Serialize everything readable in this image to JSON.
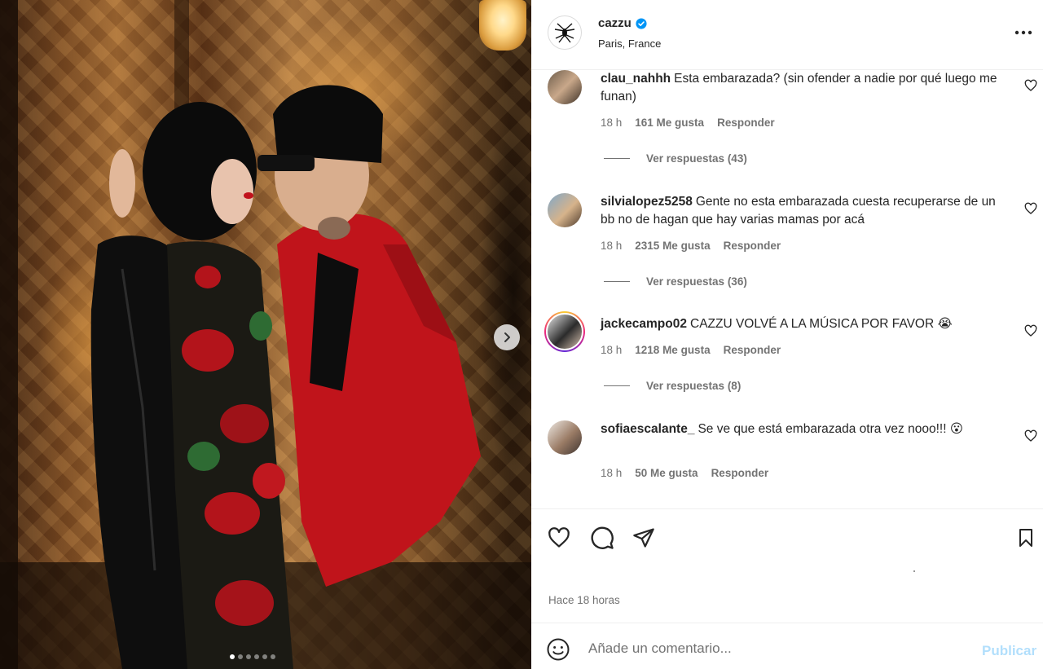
{
  "post": {
    "username": "cazzu",
    "verified": true,
    "location": "Paris, France",
    "time_ago": "Hace 18 horas",
    "carousel_count": 6,
    "carousel_index": 1
  },
  "comments": [
    {
      "username": "clau_nahhh",
      "text": "Esta embarazada? (sin ofender a nadie por qué luego me funan)",
      "time": "18 h",
      "likes": "161 Me gusta",
      "reply_label": "Responder",
      "replies": "Ver respuestas (43)"
    },
    {
      "username": "silvialopez5258",
      "text": "Gente no esta embarazada cuesta recuperarse de un bb no de hagan que hay varias mamas por acá",
      "time": "18 h",
      "likes": "2315 Me gusta",
      "reply_label": "Responder",
      "replies": "Ver respuestas (36)"
    },
    {
      "username": "jackecampo02",
      "text": "CAZZU VOLVÉ A LA MÚSICA POR FAVOR 😭",
      "time": "18 h",
      "likes": "1218 Me gusta",
      "reply_label": "Responder",
      "replies": "Ver respuestas (8)"
    },
    {
      "username": "sofiaescalante_",
      "text": "Se ve que está embarazada otra vez nooo!!! 😮",
      "time": "18 h",
      "likes": "50 Me gusta",
      "reply_label": "Responder"
    }
  ],
  "composer": {
    "placeholder": "Añade un comentario...",
    "post_label": "Publicar"
  },
  "icons": {
    "verified": "verified-badge-icon",
    "more": "more-options-icon",
    "like": "heart-icon",
    "comment": "comment-icon",
    "share": "send-icon",
    "save": "bookmark-icon",
    "emoji": "emoji-icon",
    "next": "chevron-right-icon"
  },
  "colors": {
    "verified": "#0095f6",
    "post_disabled": "#b2dffc",
    "muted": "#737373"
  }
}
